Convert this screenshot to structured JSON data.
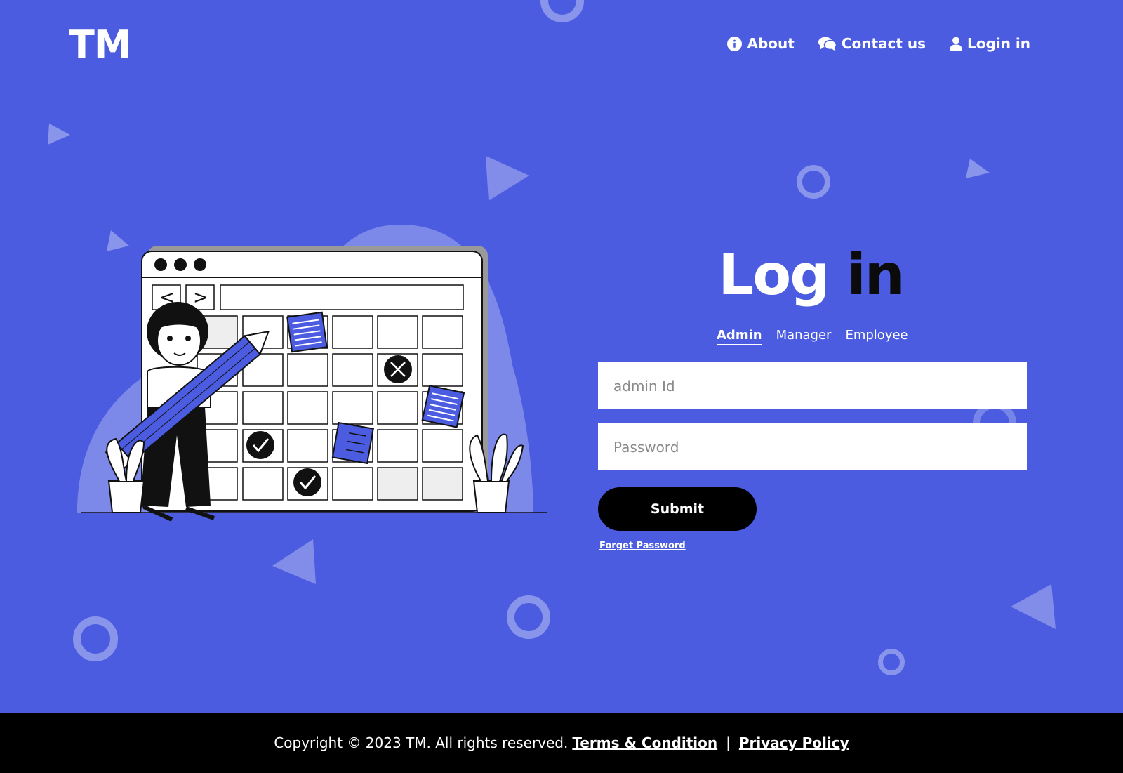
{
  "header": {
    "logo": "TM",
    "nav": [
      {
        "label": "About",
        "icon": "info-circle-icon"
      },
      {
        "label": "Contact us",
        "icon": "comments-icon"
      },
      {
        "label": "Login in",
        "icon": "user-icon"
      }
    ]
  },
  "login": {
    "title_part1": "Log",
    "title_part2": "in",
    "tabs": [
      {
        "label": "Admin",
        "active": true
      },
      {
        "label": "Manager",
        "active": false
      },
      {
        "label": "Employee",
        "active": false
      }
    ],
    "id_placeholder": "admin Id",
    "password_placeholder": "Password",
    "submit_label": "Submit",
    "forget_label": "Forget Password"
  },
  "footer": {
    "copyright": "Copyright ©  2023 TM. All rights reserved.",
    "terms": "Terms & Condition",
    "separator": "|",
    "privacy": "Privacy Policy"
  },
  "colors": {
    "background": "#4b5ce0",
    "footer": "#000000",
    "title_dark": "#0b0b0b"
  }
}
